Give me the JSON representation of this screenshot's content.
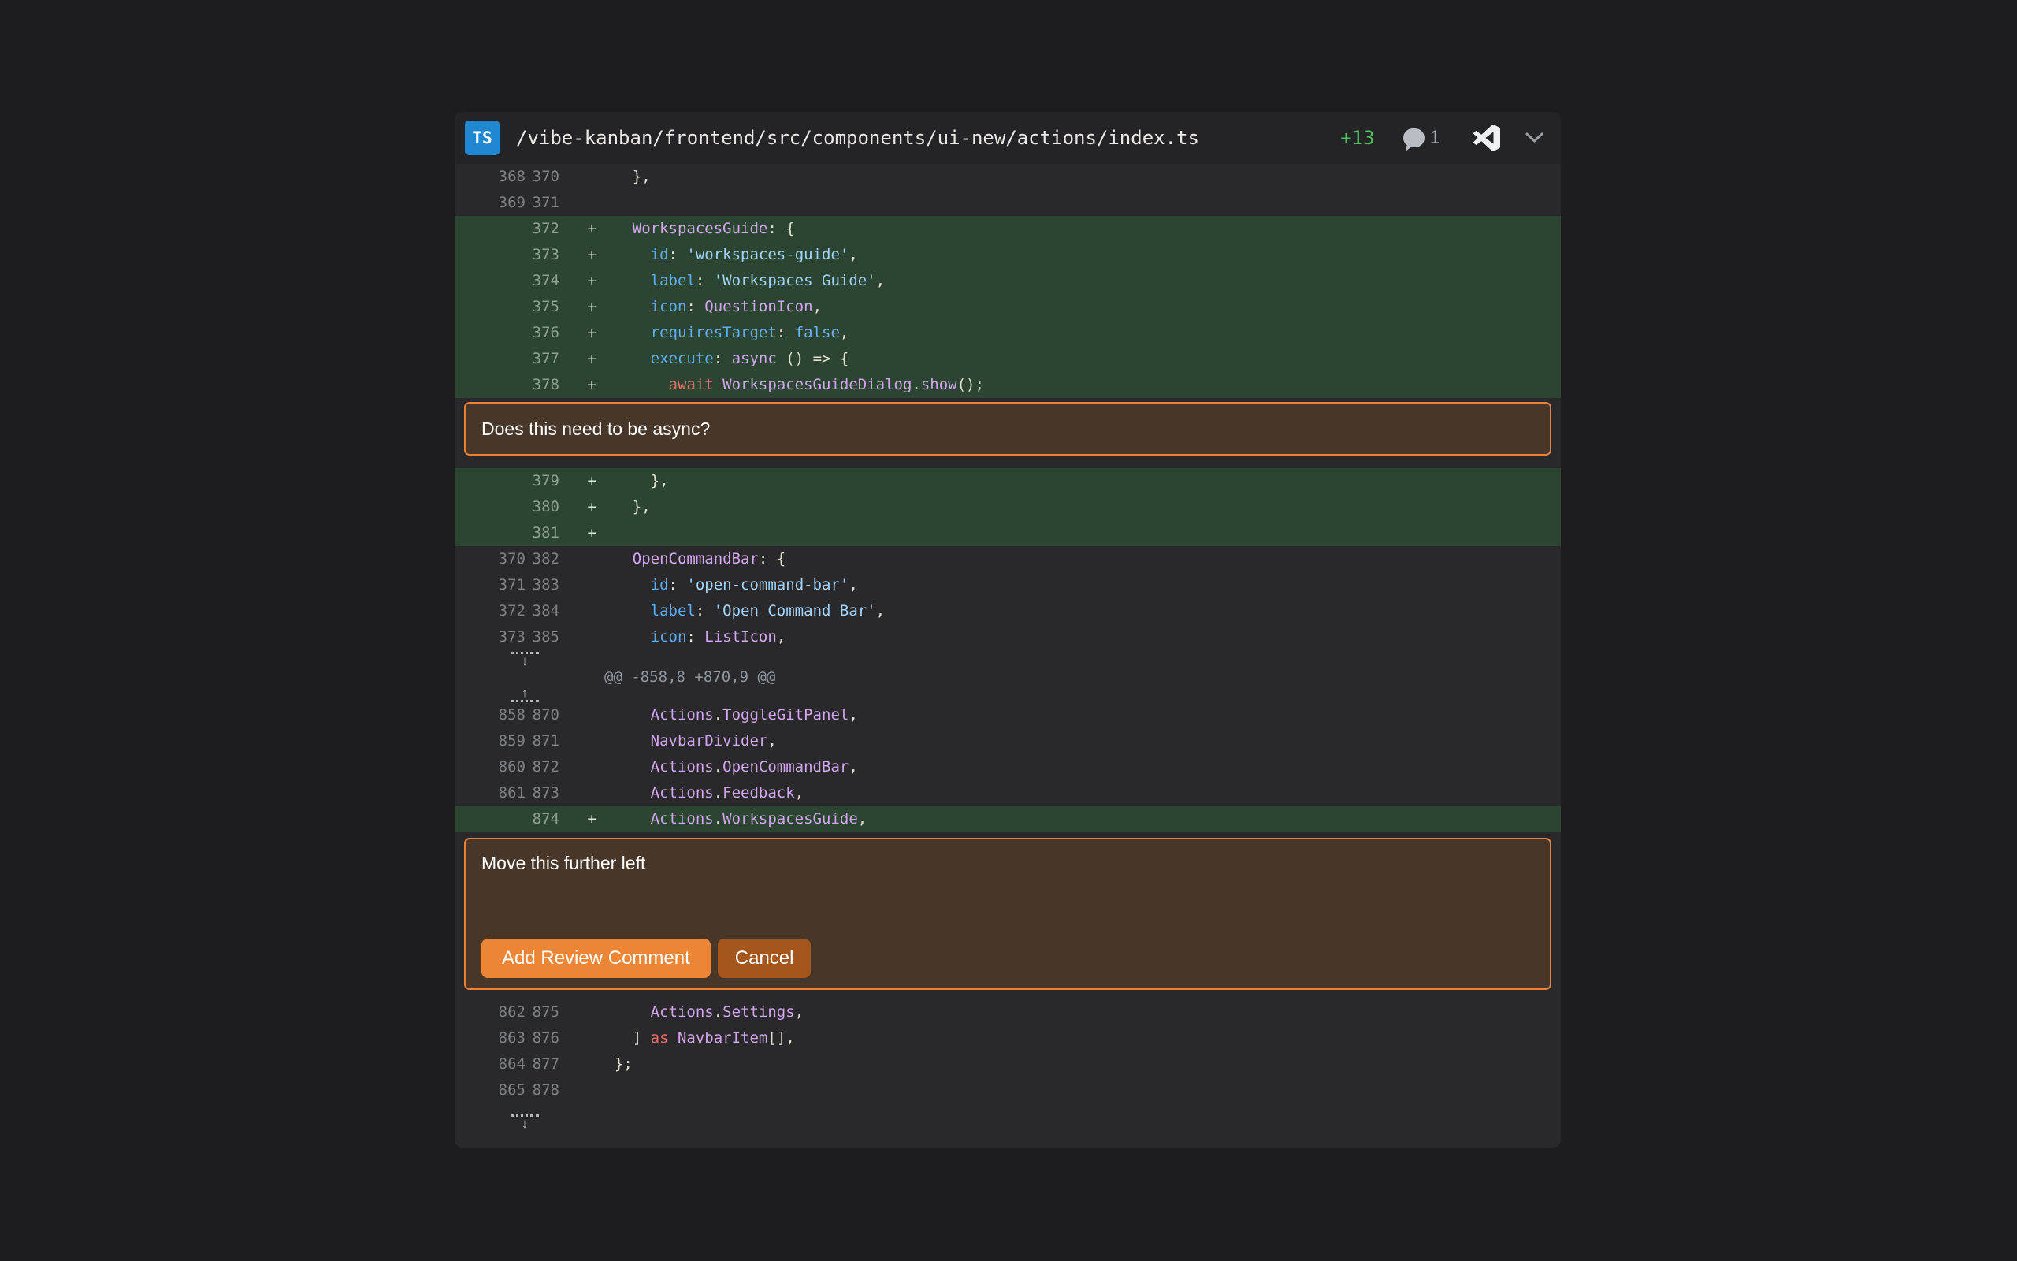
{
  "palette": {
    "page_bg": "#1d1d1f",
    "panel_bg": "#29292b",
    "header_bg": "#242427",
    "added_row_bg": "#2b4532",
    "accent_orange": "#e8823a",
    "comment_box_bg": "#483729",
    "primary_button_bg": "#ec8636",
    "secondary_button_bg": "#a4561d",
    "additions_green": "#4fc159",
    "ts_badge_blue": "#2088d2"
  },
  "icons": {
    "ts_badge": "TS",
    "comment_bubble": "comment-bubble",
    "vscode": "vscode-logo",
    "chevron": "chevron-down",
    "expand_down_arrow": "↓",
    "expand_up_arrow": "↑",
    "add_marker": "+"
  },
  "header": {
    "badge": "TS",
    "file_path": "/vibe-kanban/frontend/src/components/ui-new/actions/index.ts",
    "additions": "+13",
    "comment_count": "1"
  },
  "diff": {
    "blocks": [
      {
        "type": "rows",
        "rows": [
          {
            "old": "368",
            "new": "370",
            "kind": "ctx",
            "segs": [
              [
                "    },",
                "plain"
              ]
            ]
          },
          {
            "old": "369",
            "new": "371",
            "kind": "ctx",
            "segs": []
          },
          {
            "old": "",
            "new": "372",
            "kind": "add",
            "segs": [
              [
                "    ",
                "plain"
              ],
              [
                "WorkspacesGuide",
                "ident"
              ],
              [
                ": {",
                "plain"
              ]
            ]
          },
          {
            "old": "",
            "new": "373",
            "kind": "add",
            "segs": [
              [
                "      ",
                "plain"
              ],
              [
                "id",
                "prop"
              ],
              [
                ": ",
                "plain"
              ],
              [
                "'workspaces-guide'",
                "str"
              ],
              [
                ",",
                "plain"
              ]
            ]
          },
          {
            "old": "",
            "new": "374",
            "kind": "add",
            "segs": [
              [
                "      ",
                "plain"
              ],
              [
                "label",
                "prop"
              ],
              [
                ": ",
                "plain"
              ],
              [
                "'Workspaces Guide'",
                "str"
              ],
              [
                ",",
                "plain"
              ]
            ]
          },
          {
            "old": "",
            "new": "375",
            "kind": "add",
            "segs": [
              [
                "      ",
                "plain"
              ],
              [
                "icon",
                "prop"
              ],
              [
                ": ",
                "plain"
              ],
              [
                "QuestionIcon",
                "ident"
              ],
              [
                ",",
                "plain"
              ]
            ]
          },
          {
            "old": "",
            "new": "376",
            "kind": "add",
            "segs": [
              [
                "      ",
                "plain"
              ],
              [
                "requiresTarget",
                "prop"
              ],
              [
                ": ",
                "plain"
              ],
              [
                "false",
                "bool"
              ],
              [
                ",",
                "plain"
              ]
            ]
          },
          {
            "old": "",
            "new": "377",
            "kind": "add",
            "segs": [
              [
                "      ",
                "plain"
              ],
              [
                "execute",
                "prop"
              ],
              [
                ": ",
                "plain"
              ],
              [
                "async",
                "ident"
              ],
              [
                " () => {",
                "plain"
              ]
            ]
          },
          {
            "old": "",
            "new": "378",
            "kind": "add",
            "segs": [
              [
                "        ",
                "plain"
              ],
              [
                "await",
                "kw"
              ],
              [
                " ",
                "plain"
              ],
              [
                "WorkspacesGuideDialog",
                "ident"
              ],
              [
                ".",
                "plain"
              ],
              [
                "show",
                "ident"
              ],
              [
                "();",
                "plain"
              ]
            ]
          }
        ]
      },
      {
        "type": "comment",
        "text": "Does this need to be async?"
      },
      {
        "type": "rows",
        "rows": [
          {
            "old": "",
            "new": "379",
            "kind": "add",
            "segs": [
              [
                "      },",
                "plain"
              ]
            ]
          },
          {
            "old": "",
            "new": "380",
            "kind": "add",
            "segs": [
              [
                "    },",
                "plain"
              ]
            ]
          },
          {
            "old": "",
            "new": "381",
            "kind": "add",
            "segs": []
          },
          {
            "old": "370",
            "new": "382",
            "kind": "ctx",
            "segs": [
              [
                "    ",
                "plain"
              ],
              [
                "OpenCommandBar",
                "ident"
              ],
              [
                ": {",
                "plain"
              ]
            ]
          },
          {
            "old": "371",
            "new": "383",
            "kind": "ctx",
            "segs": [
              [
                "      ",
                "plain"
              ],
              [
                "id",
                "prop"
              ],
              [
                ": ",
                "plain"
              ],
              [
                "'open-command-bar'",
                "str"
              ],
              [
                ",",
                "plain"
              ]
            ]
          },
          {
            "old": "372",
            "new": "384",
            "kind": "ctx",
            "segs": [
              [
                "      ",
                "plain"
              ],
              [
                "label",
                "prop"
              ],
              [
                ": ",
                "plain"
              ],
              [
                "'Open Command Bar'",
                "str"
              ],
              [
                ",",
                "plain"
              ]
            ]
          },
          {
            "old": "373",
            "new": "385",
            "kind": "ctx",
            "segs": [
              [
                "      ",
                "plain"
              ],
              [
                "icon",
                "prop"
              ],
              [
                ": ",
                "plain"
              ],
              [
                "ListIcon",
                "ident"
              ],
              [
                ",",
                "plain"
              ]
            ]
          }
        ]
      },
      {
        "type": "separator",
        "hunk_header": "@@ -858,8 +870,9 @@"
      },
      {
        "type": "rows",
        "rows": [
          {
            "old": "858",
            "new": "870",
            "kind": "ctx",
            "segs": [
              [
                "      ",
                "plain"
              ],
              [
                "Actions",
                "ident"
              ],
              [
                ".",
                "plain"
              ],
              [
                "ToggleGitPanel",
                "ident"
              ],
              [
                ",",
                "plain"
              ]
            ]
          },
          {
            "old": "859",
            "new": "871",
            "kind": "ctx",
            "segs": [
              [
                "      ",
                "plain"
              ],
              [
                "NavbarDivider",
                "ident"
              ],
              [
                ",",
                "plain"
              ]
            ]
          },
          {
            "old": "860",
            "new": "872",
            "kind": "ctx",
            "segs": [
              [
                "      ",
                "plain"
              ],
              [
                "Actions",
                "ident"
              ],
              [
                ".",
                "plain"
              ],
              [
                "OpenCommandBar",
                "ident"
              ],
              [
                ",",
                "plain"
              ]
            ]
          },
          {
            "old": "861",
            "new": "873",
            "kind": "ctx",
            "segs": [
              [
                "      ",
                "plain"
              ],
              [
                "Actions",
                "ident"
              ],
              [
                ".",
                "plain"
              ],
              [
                "Feedback",
                "ident"
              ],
              [
                ",",
                "plain"
              ]
            ]
          },
          {
            "old": "",
            "new": "874",
            "kind": "add",
            "segs": [
              [
                "      ",
                "plain"
              ],
              [
                "Actions",
                "ident"
              ],
              [
                ".",
                "plain"
              ],
              [
                "WorkspacesGuide",
                "ident"
              ],
              [
                ",",
                "plain"
              ]
            ]
          }
        ]
      },
      {
        "type": "editor",
        "text": "Move this further left",
        "primary_label": "Add Review Comment",
        "secondary_label": "Cancel"
      },
      {
        "type": "rows",
        "rows": [
          {
            "old": "862",
            "new": "875",
            "kind": "ctx",
            "segs": [
              [
                "      ",
                "plain"
              ],
              [
                "Actions",
                "ident"
              ],
              [
                ".",
                "plain"
              ],
              [
                "Settings",
                "ident"
              ],
              [
                ",",
                "plain"
              ]
            ]
          },
          {
            "old": "863",
            "new": "876",
            "kind": "ctx",
            "segs": [
              [
                "    ] ",
                "plain"
              ],
              [
                "as",
                "kw"
              ],
              [
                " ",
                "plain"
              ],
              [
                "NavbarItem",
                "ident"
              ],
              [
                "[],",
                "plain"
              ]
            ]
          },
          {
            "old": "864",
            "new": "877",
            "kind": "ctx",
            "segs": [
              [
                "  };",
                "plain"
              ]
            ]
          },
          {
            "old": "865",
            "new": "878",
            "kind": "ctx",
            "segs": []
          }
        ]
      },
      {
        "type": "expand_down"
      }
    ]
  }
}
